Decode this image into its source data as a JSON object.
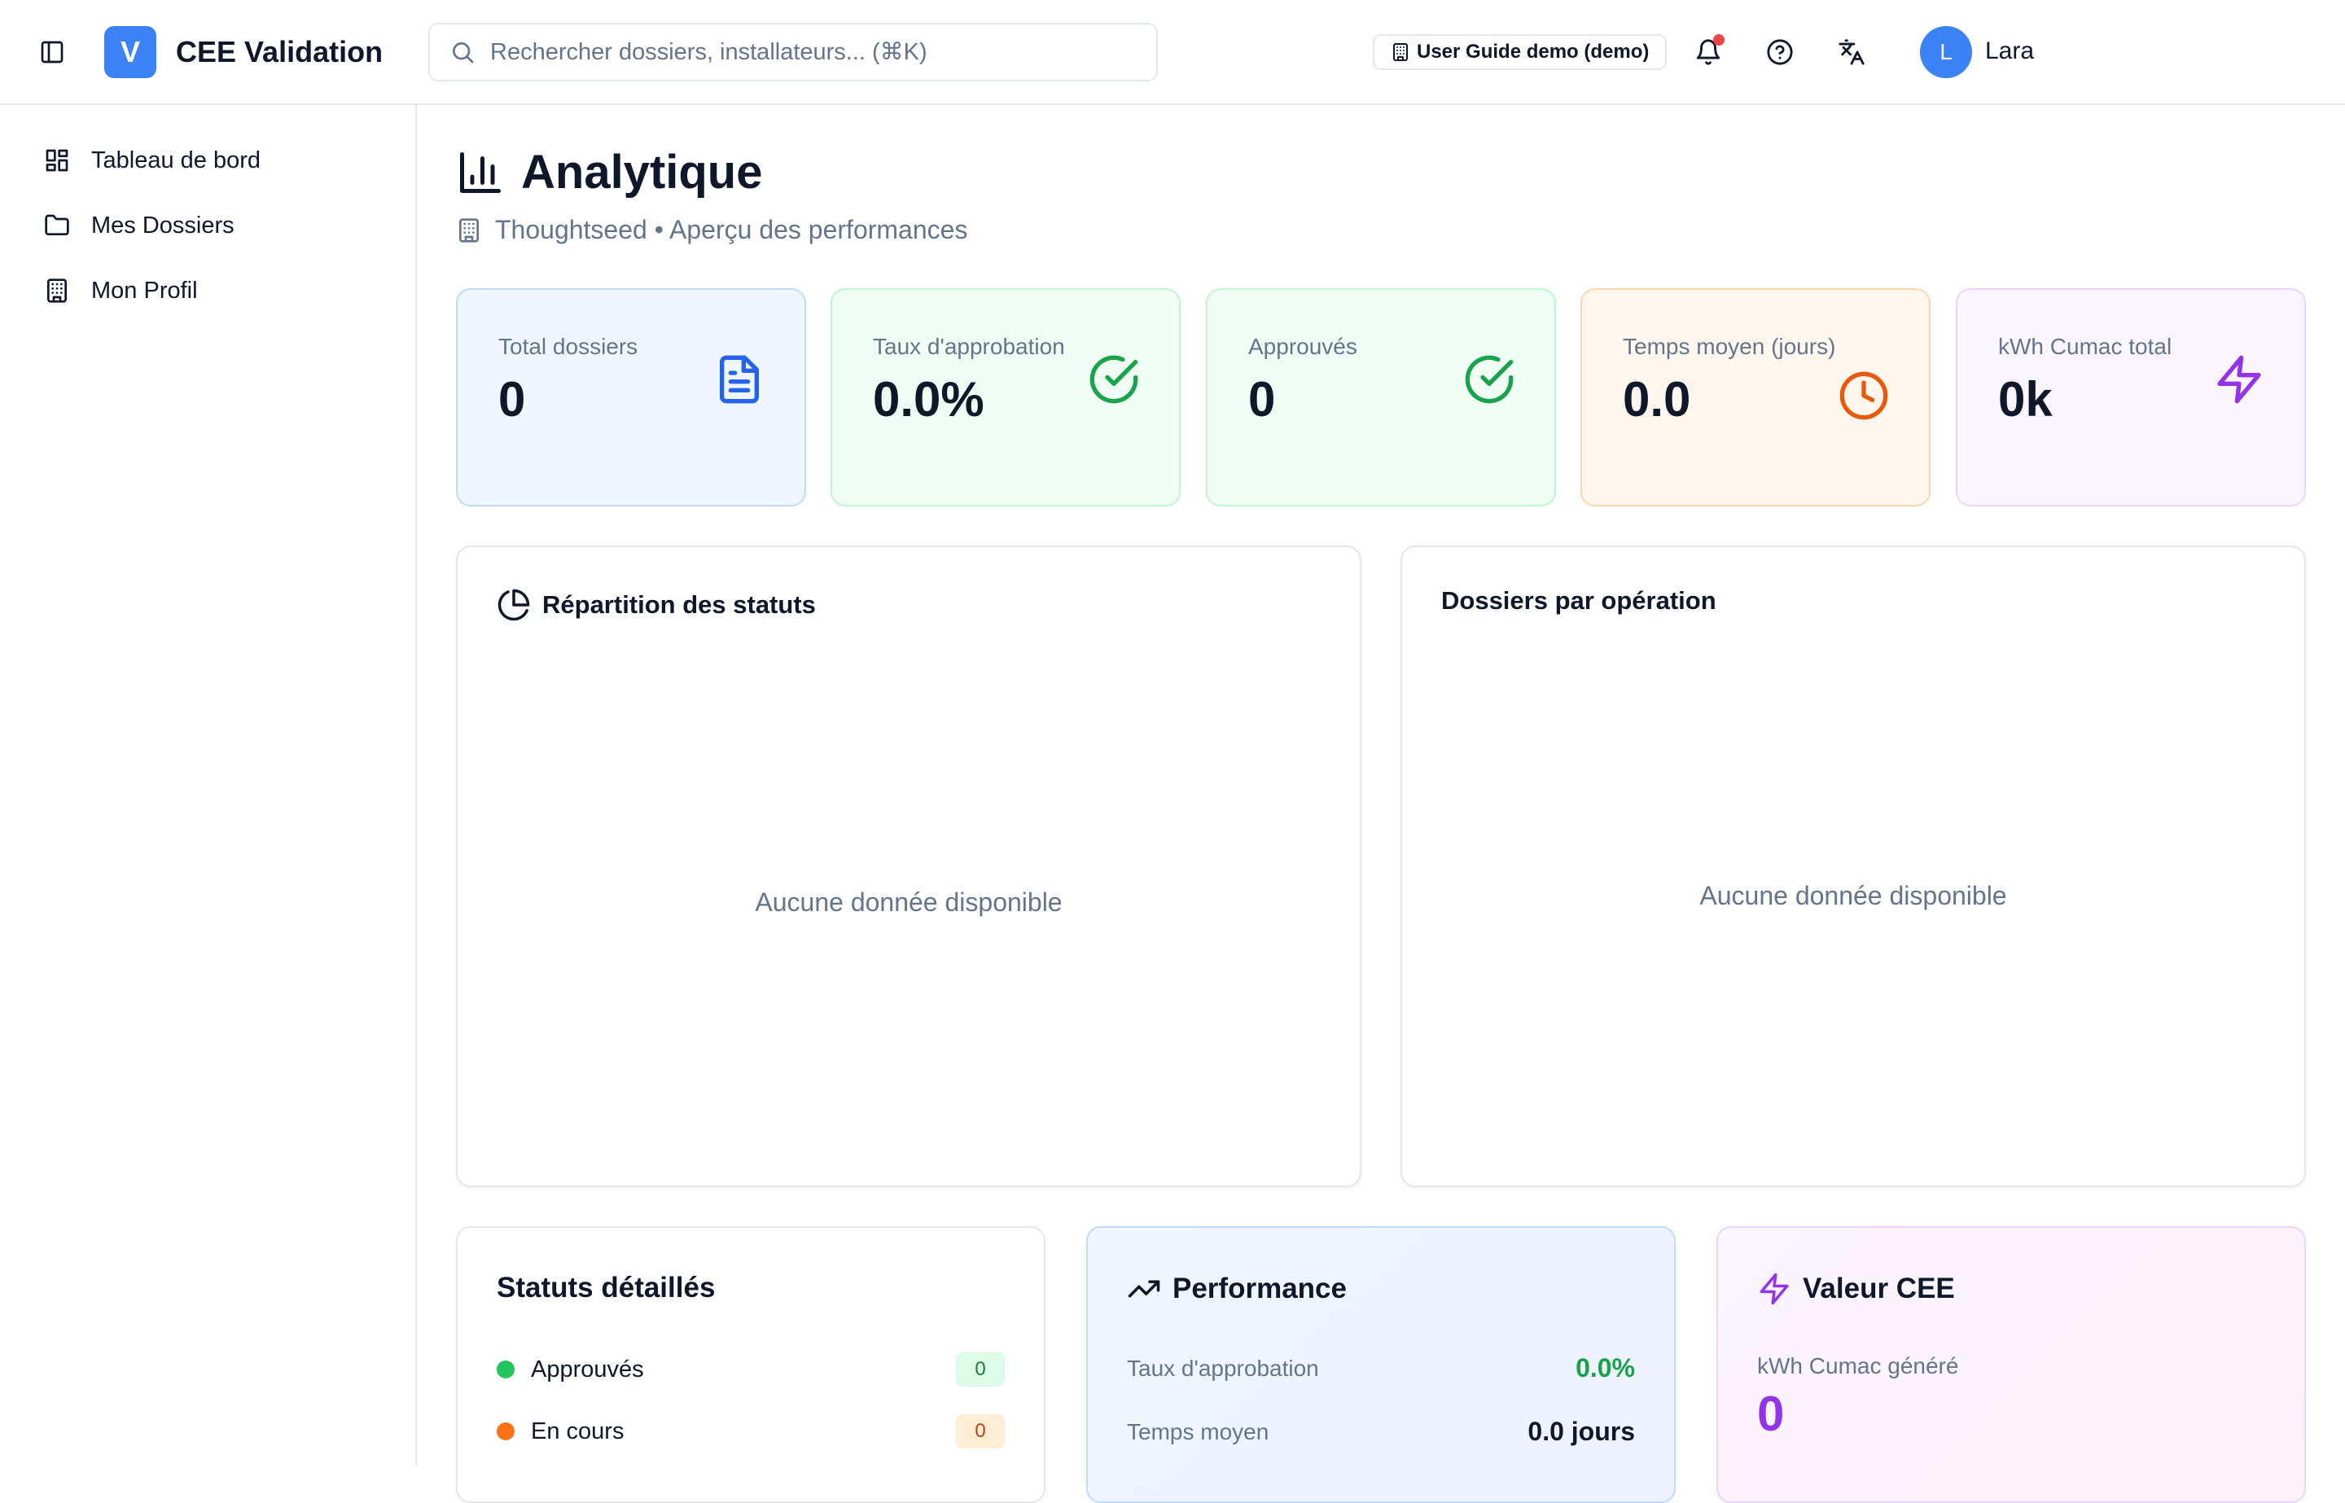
{
  "header": {
    "app_logo_letter": "V",
    "app_title": "CEE Validation",
    "search_placeholder": "Rechercher dossiers, installateurs... (⌘K)",
    "demo_badge": "User Guide demo (demo)",
    "user_initial": "L",
    "user_name": "Lara"
  },
  "sidebar": {
    "items": [
      {
        "label": "Tableau de bord",
        "icon": "dashboard-icon"
      },
      {
        "label": "Mes Dossiers",
        "icon": "folder-icon"
      },
      {
        "label": "Mon Profil",
        "icon": "building-icon"
      }
    ]
  },
  "page": {
    "title": "Analytique",
    "subtitle": "Thoughtseed • Aperçu des performances"
  },
  "stats": [
    {
      "label": "Total dossiers",
      "value": "0",
      "icon": "file-text-icon",
      "color": "#2563eb"
    },
    {
      "label": "Taux d'approbation",
      "value": "0.0%",
      "icon": "check-circle-icon",
      "color": "#16a34a"
    },
    {
      "label": "Approuvés",
      "value": "0",
      "icon": "check-circle-icon",
      "color": "#16a34a"
    },
    {
      "label": "Temps moyen (jours)",
      "value": "0.0",
      "icon": "clock-icon",
      "color": "#ea580c"
    },
    {
      "label": "kWh Cumac total",
      "value": "0k",
      "icon": "zap-icon",
      "color": "#9333ea"
    }
  ],
  "status_chart": {
    "title": "Répartition des statuts",
    "empty": "Aucune donnée disponible"
  },
  "operation_chart": {
    "title": "Dossiers par opération",
    "empty": "Aucune donnée disponible"
  },
  "detailed_statuses": {
    "title": "Statuts détaillés",
    "rows": [
      {
        "label": "Approuvés",
        "count": "0",
        "color": "#22c55e"
      },
      {
        "label": "En cours",
        "count": "0",
        "color": "#f97316"
      }
    ]
  },
  "performance": {
    "title": "Performance",
    "approval_label": "Taux d'approbation",
    "approval_value": "0.0%",
    "avg_label": "Temps moyen",
    "avg_value": "0.0 jours"
  },
  "cee_value": {
    "title": "Valeur CEE",
    "kwh_label": "kWh Cumac généré",
    "kwh_value": "0"
  },
  "colors": {
    "accent": "#3b82f6",
    "success": "#16a34a",
    "warning": "#ea580c",
    "purple": "#9333ea",
    "notification": "#ef4444"
  }
}
